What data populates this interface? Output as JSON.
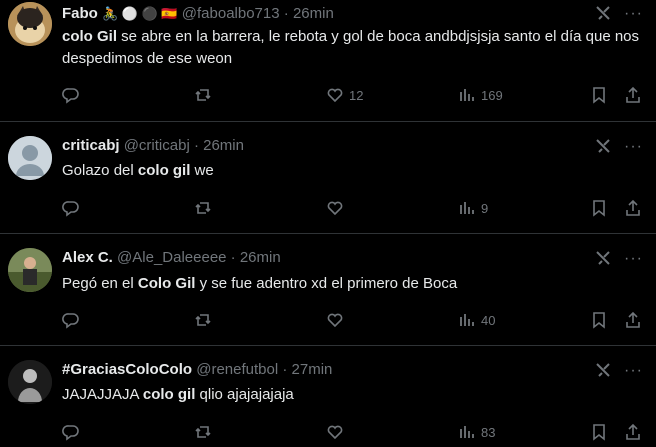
{
  "tweets": [
    {
      "name": "Fabo",
      "emojis": "🚴 ⚪ ⚫ 🇪🇸",
      "handle": "@faboalbo713",
      "separator": "·",
      "time": "26min",
      "text_segments": [
        {
          "t": "colo Gil",
          "bold": true
        },
        {
          "t": " se abre en la barrera, le rebota y gol de boca andbdjsjsja santo el día que nos despedimos de ese weon",
          "bold": false
        }
      ],
      "replies": "",
      "retweets": "",
      "likes": "12",
      "views": "169"
    },
    {
      "name": "criticabj",
      "emojis": "",
      "handle": "@criticabj",
      "separator": "·",
      "time": "26min",
      "text_segments": [
        {
          "t": "Golazo del ",
          "bold": false
        },
        {
          "t": "colo gil",
          "bold": true
        },
        {
          "t": " we",
          "bold": false
        }
      ],
      "replies": "",
      "retweets": "",
      "likes": "",
      "views": "9"
    },
    {
      "name": "Alex C.",
      "emojis": "",
      "handle": "@Ale_Daleeeee",
      "separator": "·",
      "time": "26min",
      "text_segments": [
        {
          "t": "Pegó en el ",
          "bold": false
        },
        {
          "t": "Colo Gil",
          "bold": true
        },
        {
          "t": " y se fue adentro xd el primero de Boca",
          "bold": false
        }
      ],
      "replies": "",
      "retweets": "",
      "likes": "",
      "views": "40"
    },
    {
      "name": "#GraciasColoColo",
      "emojis": "",
      "handle": "@renefutbol",
      "separator": "·",
      "time": "27min",
      "text_segments": [
        {
          "t": "JAJAJJAJA ",
          "bold": false
        },
        {
          "t": "colo gil",
          "bold": true
        },
        {
          "t": " qlio ajajajajaja",
          "bold": false
        }
      ],
      "replies": "",
      "retweets": "",
      "likes": "",
      "views": "83"
    }
  ],
  "more_glyph": "···",
  "colors": {
    "background": "#000000",
    "text": "#e7e9ea",
    "muted": "#71767b",
    "border": "#2f3336"
  }
}
